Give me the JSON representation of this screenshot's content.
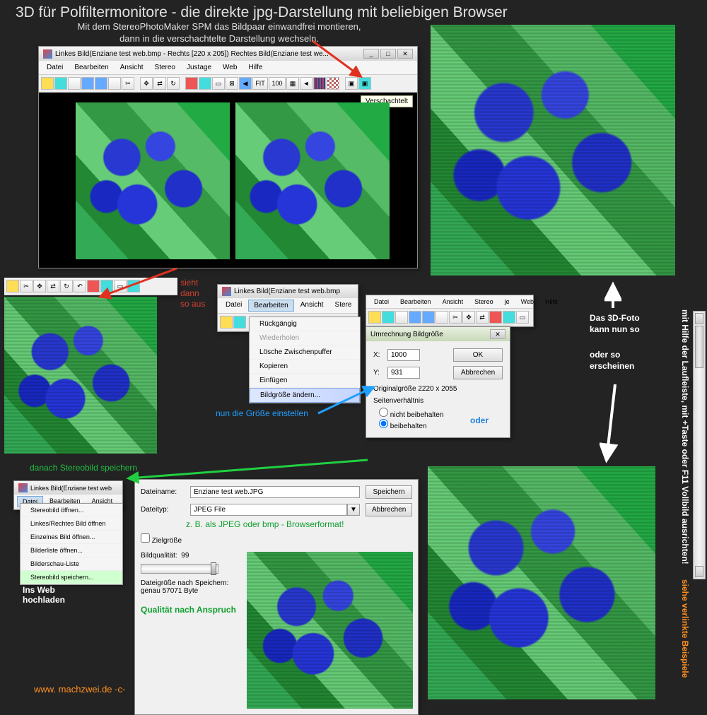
{
  "title": "3D für Polfiltermonitore - die direkte jpg-Darstellung mit beliebigen Browser",
  "subtitle": "Mit dem StereoPhotoMaker SPM  das Bildpaar einwandfrei montieren,\ndann in die verschachtelte Darstellung wechseln.",
  "main_window": {
    "title": "Linkes Bild(Enziane test web.bmp - Rechts [220 x 205]) Rechtes Bild(Enziane test we...",
    "menus": [
      "Datei",
      "Bearbeiten",
      "Ansicht",
      "Stereo",
      "Justage",
      "Web",
      "Hilfe"
    ],
    "tooltip": "Verschachtelt",
    "fit_label": "FIT",
    "zoom": "100"
  },
  "annotations": {
    "sieht_dann": "sieht\ndann\nso aus",
    "nun_groesse": "nun die Größe einstellen",
    "oder": "oder",
    "danach": "danach Stereobild speichern",
    "format_note": "z. B. als JPEG oder bmp - Browserformat!",
    "quality_note": "Qualität nach Anspruch",
    "ins_web": "Ins Web\nhochladen",
    "das_3d": "Das 3D-Foto\nkann nun so",
    "oder_so": "oder so\nerscheinen",
    "vertical1": "mit Hilfe der Laufleiste, mit +Taste oder F11 Vollbild ausrichten!",
    "vertical2": "siehe verlinkte Beispiele"
  },
  "edit_win": {
    "title": "Linkes Bild(Enziane test web.bmp",
    "menus": [
      "Datei",
      "Bearbeiten",
      "Ansicht",
      "Stere"
    ],
    "items": {
      "undo": "Rückgängig",
      "redo": "Wiederholen",
      "clear": "Lösche Zwischenpuffer",
      "copy": "Kopieren",
      "paste": "Einfügen",
      "resize": "Bildgröße ändern..."
    }
  },
  "resize_dialog": {
    "menus": [
      "Datei",
      "Bearbeiten",
      "Ansicht",
      "Stereo",
      "je",
      "Web",
      "Hilfe"
    ],
    "title": "Umrechnung Bildgröße",
    "x_label": "X:",
    "x_val": "1000",
    "y_label": "Y:",
    "y_val": "931",
    "ok": "OK",
    "cancel": "Abbrechen",
    "orig": "Originalgröße 2220 x 2055",
    "aspect": "Seitenverhältnis",
    "opt1": "nicht beibehalten",
    "opt2": "beibehalten"
  },
  "save_dialog": {
    "name_label": "Dateiname:",
    "name_val": "Enziane test web.JPG",
    "type_label": "Dateityp:",
    "type_val": "JPEG File",
    "save": "Speichern",
    "cancel": "Abbrechen",
    "target": "Zielgröße",
    "quality_label": "Bildqualität:",
    "quality_val": "99",
    "filesize": "Dateigröße nach Speichern:\ngenau 57071 Byte"
  },
  "file_menu": {
    "title": "Linkes Bild(Enziane test web",
    "menus": [
      "Datei",
      "Bearbeiten",
      "Ansicht"
    ],
    "items": [
      "Stereobild öffnen...",
      "Linkes/Rechtes Bild öffnen",
      "Einzelnes Bild öffnen...",
      "Bilderliste öffnen...",
      "Bilderschau-Liste",
      "Stereobild speichern..."
    ]
  },
  "footer": "www. machzwei.de -c-"
}
